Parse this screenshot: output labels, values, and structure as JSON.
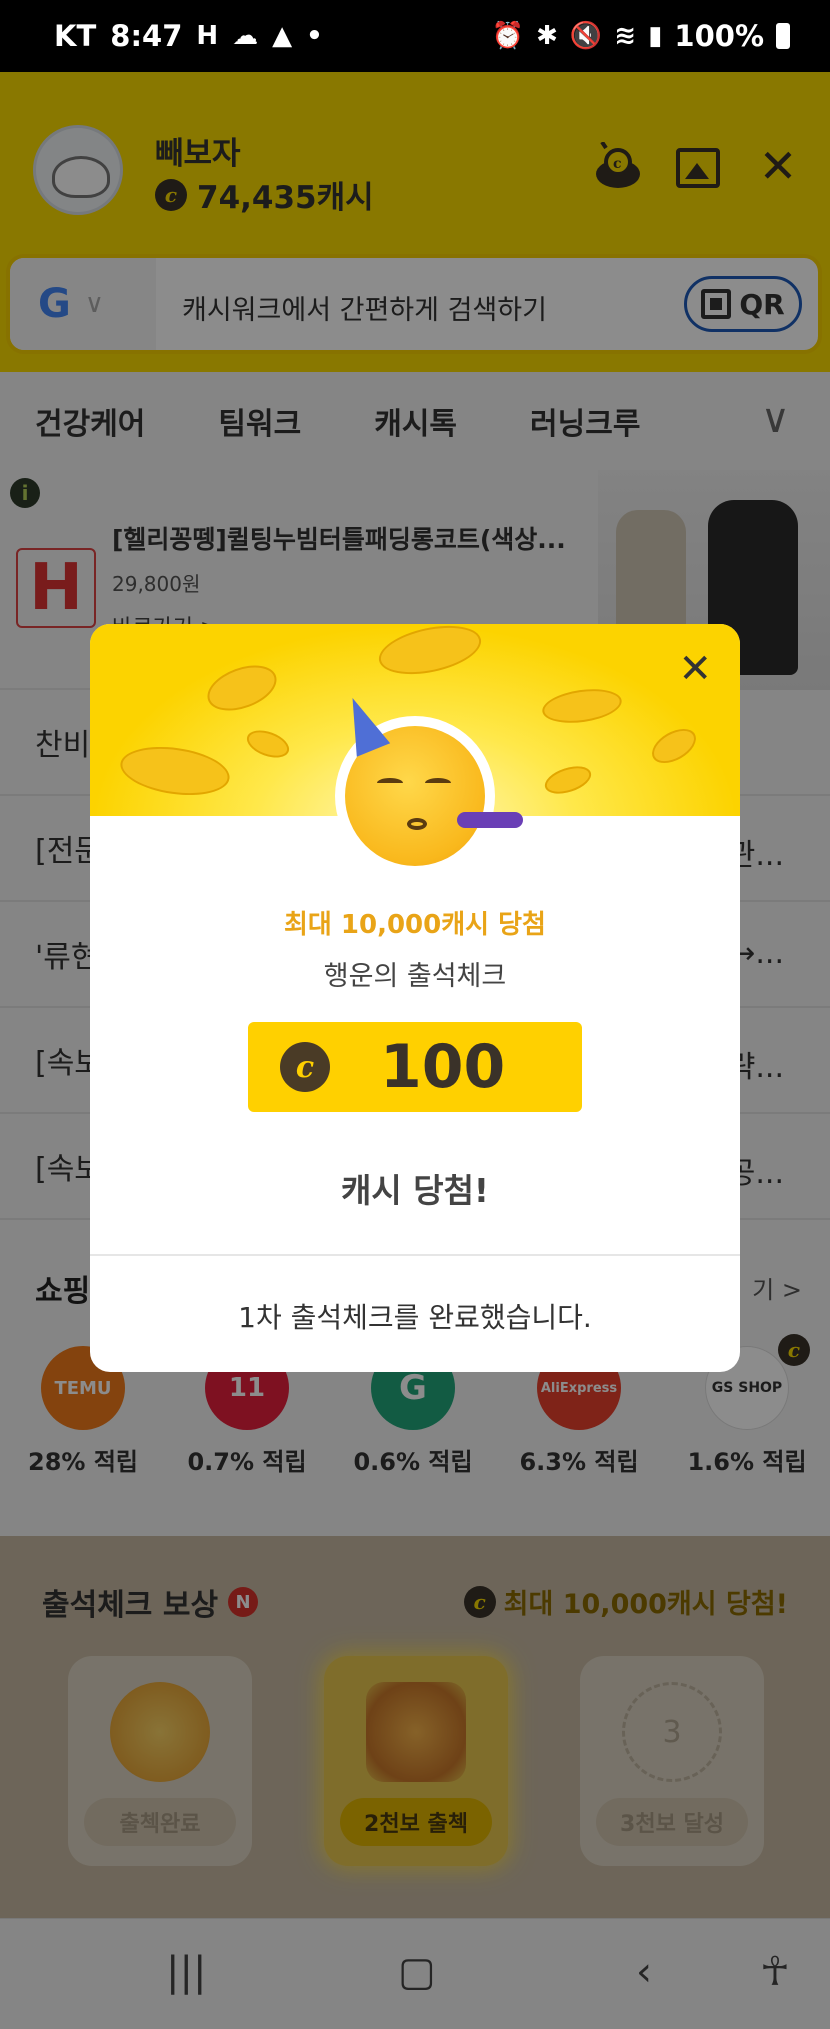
{
  "status": {
    "carrier": "KT",
    "time": "8:47",
    "battery": "100%"
  },
  "header": {
    "username": "빼보자",
    "cash": "74,435캐시"
  },
  "search": {
    "placeholder": "캐시워크에서 간편하게 검색하기",
    "qr_label": "QR"
  },
  "tabs": [
    "건강케어",
    "팀워크",
    "캐시톡",
    "러닝크루"
  ],
  "ad": {
    "title": "[헬리꽁뗑]퀼팅누빔터틀패딩롱코트(색상...",
    "price": "29,800원",
    "cta": "바로가기 >"
  },
  "news": [
    {
      "lead": "찬비",
      "trail": ""
    },
    {
      "lead": "[전문",
      "trail": "관..."
    },
    {
      "lead": "'류현",
      "trail": "→..."
    },
    {
      "lead": "[속보",
      "trail": "략..."
    },
    {
      "lead": "[속보",
      "trail": "공..."
    }
  ],
  "shopping": {
    "title": "쇼핑",
    "more": "기 >",
    "items": [
      {
        "name": "TEMU",
        "rate": "28% 적립",
        "color": "#f07a1a"
      },
      {
        "name": "11",
        "rate": "0.7% 적립",
        "color": "#e5203c"
      },
      {
        "name": "G",
        "rate": "0.6% 적립",
        "color": "#21a67a"
      },
      {
        "name": "AliExpress",
        "rate": "6.3% 적립",
        "color": "#e8412c"
      },
      {
        "name": "GS SHOP",
        "rate": "1.6% 적립",
        "color": "#ffffff"
      }
    ]
  },
  "attendance": {
    "title": "출석체크 보상",
    "badge": "N",
    "promo": "최대 10,000캐시 당첨!",
    "cards": [
      {
        "label": "출첵완료"
      },
      {
        "label": "2천보 출첵"
      },
      {
        "label": "3천보 달성",
        "number": "3"
      }
    ]
  },
  "modal": {
    "headline": "최대 10,000캐시 당첨",
    "subtitle": "행운의 출석체크",
    "amount": "100",
    "result": "캐시 당첨!",
    "message": "1차 출석체크를 완료했습니다."
  },
  "colors": {
    "brand_yellow": "#fadb00",
    "accent_orange": "#e9a417"
  }
}
